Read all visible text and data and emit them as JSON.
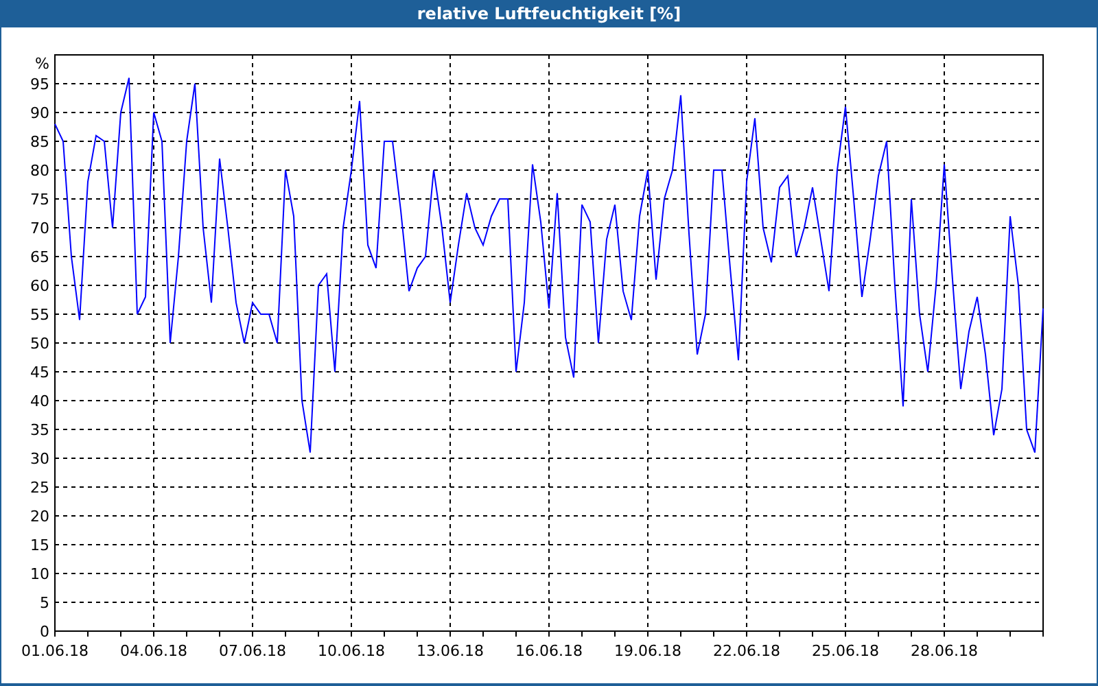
{
  "window": {
    "title": "relative Luftfeuchtigkeit [%]"
  },
  "chart": {
    "chart_data": {
      "type": "line",
      "grid": true,
      "ylabel": "%",
      "ylim": [
        0,
        100
      ],
      "yticks": [
        0,
        5,
        10,
        15,
        20,
        25,
        30,
        35,
        40,
        45,
        50,
        55,
        60,
        65,
        70,
        75,
        80,
        85,
        90,
        95
      ],
      "categories": [
        "01.06.18",
        null,
        null,
        null,
        null,
        null,
        null,
        null,
        null,
        null,
        null,
        null,
        "04.06.18",
        null,
        null,
        null,
        null,
        null,
        null,
        null,
        null,
        null,
        null,
        null,
        "07.06.18",
        null,
        null,
        null,
        null,
        null,
        null,
        null,
        null,
        null,
        null,
        null,
        "10.06.18",
        null,
        null,
        null,
        null,
        null,
        null,
        null,
        null,
        null,
        null,
        null,
        "13.06.18",
        null,
        null,
        null,
        null,
        null,
        null,
        null,
        null,
        null,
        null,
        null,
        "16.06.18",
        null,
        null,
        null,
        null,
        null,
        null,
        null,
        null,
        null,
        null,
        null,
        "19.06.18",
        null,
        null,
        null,
        null,
        null,
        null,
        null,
        null,
        null,
        null,
        null,
        "22.06.18",
        null,
        null,
        null,
        null,
        null,
        null,
        null,
        null,
        null,
        null,
        null,
        "25.06.18",
        null,
        null,
        null,
        null,
        null,
        null,
        null,
        null,
        null,
        null,
        null,
        "28.06.18",
        null,
        null,
        null,
        null,
        null,
        null,
        null,
        null,
        null,
        null,
        null,
        null
      ],
      "series": [
        {
          "color": "#0000ff",
          "values": [
            88,
            85,
            65,
            54,
            78,
            86,
            85,
            70,
            90,
            96,
            55,
            58,
            90,
            85,
            50,
            65,
            85,
            95,
            70,
            57,
            82,
            70,
            57,
            50,
            57,
            55,
            55,
            50,
            80,
            72,
            40,
            31,
            60,
            62,
            45,
            70,
            80,
            92,
            67,
            63,
            85,
            85,
            73,
            59,
            63,
            65,
            80,
            70,
            57,
            67,
            76,
            70,
            67,
            72,
            75,
            75,
            45,
            57,
            81,
            71,
            56,
            76,
            51,
            44,
            74,
            71,
            50,
            68,
            74,
            59,
            54,
            72,
            80,
            61,
            75,
            80,
            93,
            69,
            48,
            55,
            80,
            80,
            63,
            47,
            78,
            89,
            70,
            64,
            77,
            79,
            65,
            70,
            77,
            68,
            59,
            80,
            91,
            75,
            58,
            68,
            79,
            85,
            60,
            39,
            75,
            55,
            45,
            60,
            81,
            61,
            42,
            52,
            58,
            48,
            34,
            42,
            72,
            60,
            35,
            31,
            56
          ]
        }
      ]
    }
  }
}
